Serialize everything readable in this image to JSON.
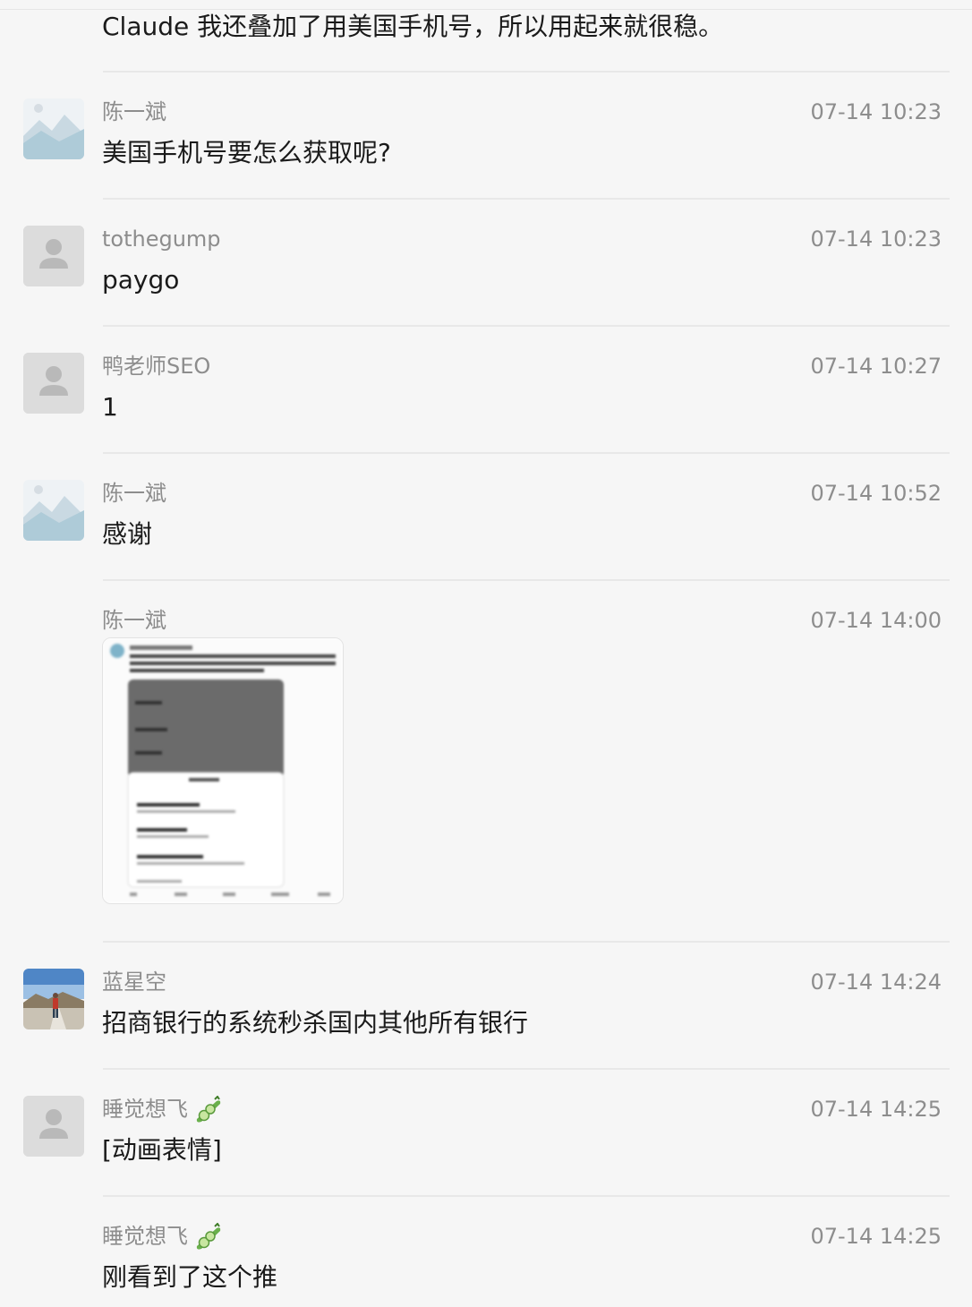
{
  "first_message": "Claude 我还叠加了用美国手机号，所以用起来就很稳。",
  "comments": [
    {
      "author": "陈一斌",
      "time": "07-14 10:23",
      "content": "美国手机号要怎么获取呢?",
      "avatar": "landscape-avatar"
    },
    {
      "author": "tothegump",
      "time": "07-14 10:23",
      "content": "paygo",
      "avatar": "default-user-avatar"
    },
    {
      "author": "鸭老师SEO",
      "time": "07-14 10:27",
      "content": "1",
      "avatar": "default-user-avatar"
    },
    {
      "author": "陈一斌",
      "time": "07-14 10:52",
      "content": "感谢",
      "avatar": "landscape-avatar"
    },
    {
      "author": "陈一斌",
      "time": "07-14 14:00",
      "content": "",
      "attachment": "image-attachment-screenshot"
    },
    {
      "author": "蓝星空",
      "time": "07-14 14:24",
      "content": "招商银行的系统秒杀国内其他所有银行",
      "avatar": "photo-avatar"
    },
    {
      "author": "睡觉想飞",
      "time": "07-14 14:25",
      "content": "[动画表情]",
      "avatar": "default-user-avatar",
      "badge": "cucumber-emoji"
    },
    {
      "author": "睡觉想飞",
      "time": "07-14 14:25",
      "content": "刚看到了这个推",
      "badge": "cucumber-emoji"
    }
  ],
  "colors": {
    "background": "#f6f6f6",
    "meta_text": "#8d8d8d",
    "separator": "#e8e8e8"
  }
}
